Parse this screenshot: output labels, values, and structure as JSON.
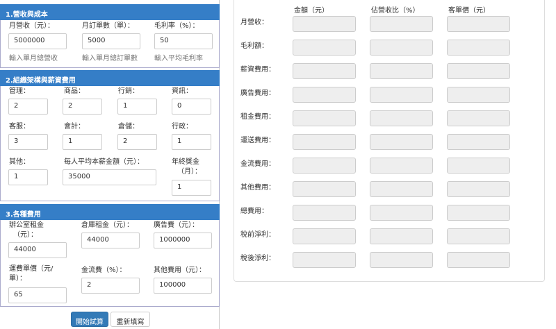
{
  "section1": {
    "title": "1.營收與成本",
    "revenue_label": "月營收（元）：",
    "revenue_value": "5000000",
    "revenue_help": "輸入單月總營收",
    "orders_label": "月訂單數（單）：",
    "orders_value": "5000",
    "orders_help": "輸入單月總訂單數",
    "margin_label": "毛利率（%）：",
    "margin_value": "50",
    "margin_help": "輸入平均毛利率"
  },
  "section2": {
    "title": "2.組織架構與薪資費用",
    "management_label": "管理：",
    "management_value": "2",
    "product_label": "商品：",
    "product_value": "2",
    "marketing_label": "行銷：",
    "marketing_value": "1",
    "it_label": "資訊：",
    "it_value": "0",
    "cs_label": "客服：",
    "cs_value": "3",
    "accounting_label": "會計：",
    "accounting_value": "1",
    "warehouse_label": "倉儲：",
    "warehouse_value": "2",
    "admin_label": "行政：",
    "admin_value": "1",
    "other_label": "其他：",
    "other_value": "1",
    "salary_label": "每人平均本薪金額（元）：",
    "salary_value": "35000",
    "bonus_label_1": "年終獎金",
    "bonus_label_2": "（月）：",
    "bonus_value": "1"
  },
  "section3": {
    "title": "3.各種費用",
    "office_rent_label_1": "辦公室租金",
    "office_rent_label_2": "（元）：",
    "office_rent_value": "44000",
    "warehouse_rent_label": "倉庫租金（元）：",
    "warehouse_rent_value": "44000",
    "ad_label": "廣告費（元）：",
    "ad_value": "1000000",
    "shipping_label_1": "運費單價（元/",
    "shipping_label_2": "單）：",
    "shipping_value": "65",
    "payment_label": "金流費（%）：",
    "payment_value": "2",
    "other_cost_label": "其他費用（元）：",
    "other_cost_value": "100000"
  },
  "buttons": {
    "start": "開始試算",
    "reset": "重新填寫"
  },
  "results": {
    "col_amount": "金額（元）",
    "col_ratio": "佔營收比（%）",
    "col_unit": "客單價（元）",
    "rows": [
      "月營收：",
      "毛利額：",
      "薪資費用：",
      "廣告費用：",
      "租金費用：",
      "運送費用：",
      "金流費用：",
      "其他費用：",
      "總費用：",
      "稅前淨利：",
      "稅後淨利："
    ]
  }
}
